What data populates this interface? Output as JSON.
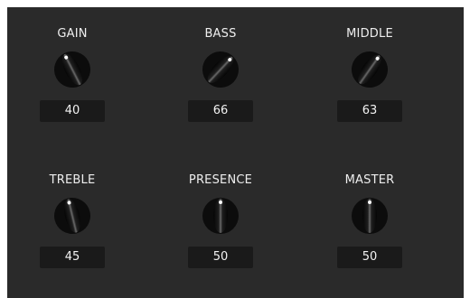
{
  "knobs": [
    {
      "id": "gain",
      "label": "GAIN",
      "value": "40",
      "level": 40
    },
    {
      "id": "bass",
      "label": "BASS",
      "value": "66",
      "level": 66
    },
    {
      "id": "middle",
      "label": "MIDDLE",
      "value": "63",
      "level": 63
    },
    {
      "id": "treble",
      "label": "TREBLE",
      "value": "45",
      "level": 45
    },
    {
      "id": "presence",
      "label": "PRESENCE",
      "value": "50",
      "level": 50
    },
    {
      "id": "master",
      "label": "MASTER",
      "value": "50",
      "level": 50
    }
  ],
  "colors": {
    "panel": "#2a2a2a",
    "value_box": "#1a1a1a",
    "label_text": "#eeeeee",
    "knob_body": "#0c0c0c",
    "indicator_dot": "#ffffff"
  },
  "icons": {
    "knob": "rotary-knob-icon"
  }
}
